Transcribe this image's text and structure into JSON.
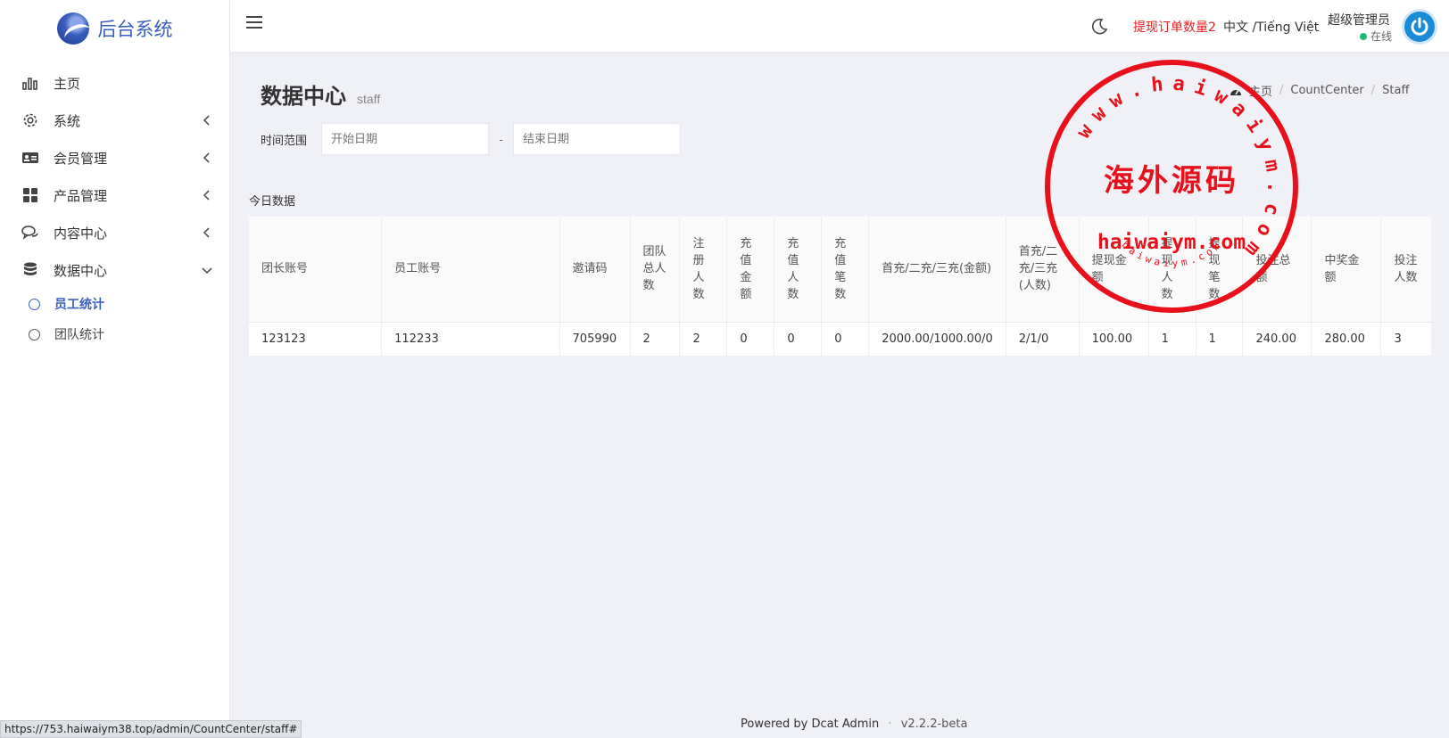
{
  "brand": {
    "title": "后台系统"
  },
  "sidebar": {
    "items": [
      {
        "label": "主页",
        "icon": "bar-chart-icon",
        "arrow": ""
      },
      {
        "label": "系统",
        "icon": "gear-icon",
        "arrow": "left"
      },
      {
        "label": "会员管理",
        "icon": "id-card-icon",
        "arrow": "left"
      },
      {
        "label": "产品管理",
        "icon": "grid-icon",
        "arrow": "left"
      },
      {
        "label": "内容中心",
        "icon": "chat-icon",
        "arrow": "left"
      },
      {
        "label": "数据中心",
        "icon": "database-icon",
        "arrow": "down"
      }
    ],
    "subitems": [
      {
        "label": "员工统计",
        "active": true
      },
      {
        "label": "团队统计",
        "active": false
      }
    ]
  },
  "topbar": {
    "withdraw_text": "提现订单数量2",
    "lang_text": "中文 /Tiếng Việt",
    "user_name": "超级管理员",
    "user_status": "在线"
  },
  "page": {
    "title": "数据中心",
    "subtitle": "staff",
    "breadcrumb": [
      "主页",
      "CountCenter",
      "Staff"
    ]
  },
  "filter": {
    "label": "时间范围",
    "start_placeholder": "开始日期",
    "end_placeholder": "结束日期",
    "dash": "-"
  },
  "section_title": "今日数据",
  "table": {
    "headers": [
      "团长账号",
      "员工账号",
      "邀请码",
      "团队总人数",
      "注册人数",
      "充值金额",
      "充值人数",
      "充值笔数",
      "首充/二充/三充(金额)",
      "首充/二充/三充(人数)",
      "提现金额",
      "提现人数",
      "提现笔数",
      "投注总额",
      "中奖金额",
      "投注人数"
    ],
    "rows": [
      [
        "123123",
        "112233",
        "705990",
        "2",
        "2",
        "0",
        "0",
        "0",
        "2000.00/1000.00/0",
        "2/1/0",
        "100.00",
        "1",
        "1",
        "240.00",
        "280.00",
        "3"
      ]
    ]
  },
  "footer": {
    "powered": "Powered by Dcat Admin",
    "dot": "·",
    "version": "v2.2.2-beta"
  },
  "status_url": "https://753.haiwaiym38.top/admin/CountCenter/staff#",
  "watermark": {
    "ring_text": "www.haiwaiym.com",
    "center_text": "海外源码",
    "sub_text": "haiwaiym.com",
    "small_text": "haiwaiym.com",
    "color": "#e8101a"
  },
  "colors": {
    "accent": "#3a5fc0",
    "danger": "#e02020",
    "online": "#21b978"
  }
}
